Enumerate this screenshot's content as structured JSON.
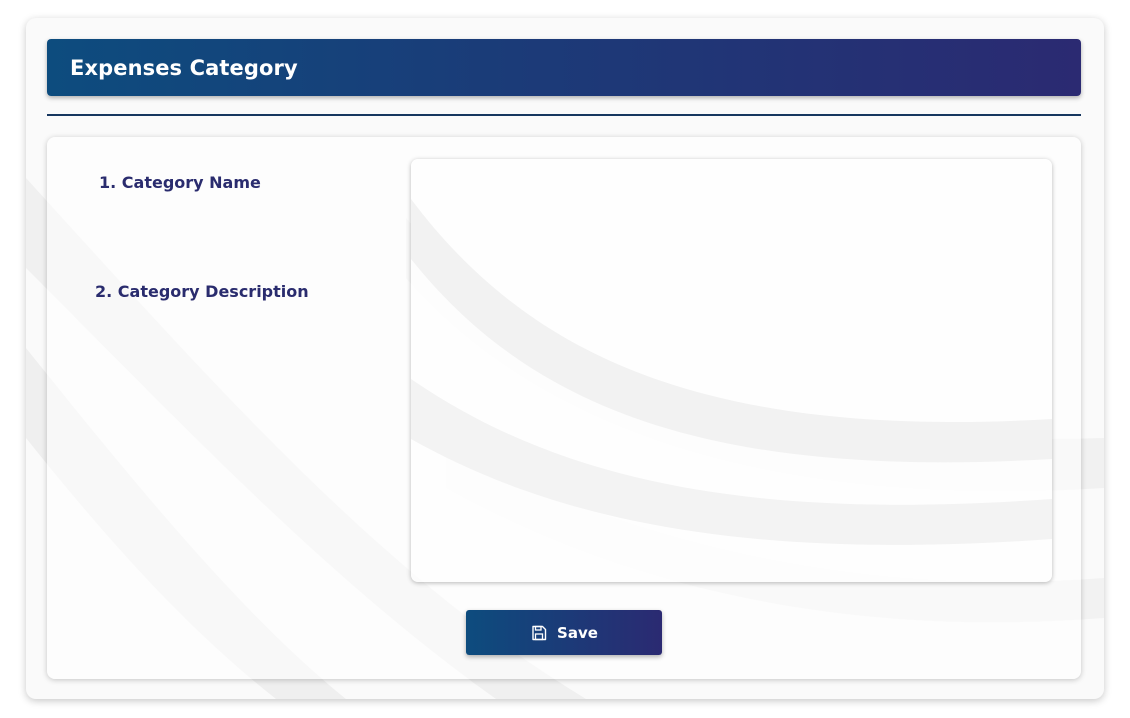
{
  "header": {
    "title": "Expenses Category"
  },
  "form": {
    "fields": [
      {
        "label": "1. Category Name"
      },
      {
        "label": "2. Category Description"
      }
    ],
    "save_label": "Save"
  },
  "colors": {
    "header_gradient_start": "#0d4c7e",
    "header_gradient_end": "#2b2a72",
    "label_color": "#2a2c6e",
    "divider_color": "#16365f"
  },
  "icons": {
    "save": "save-icon"
  }
}
